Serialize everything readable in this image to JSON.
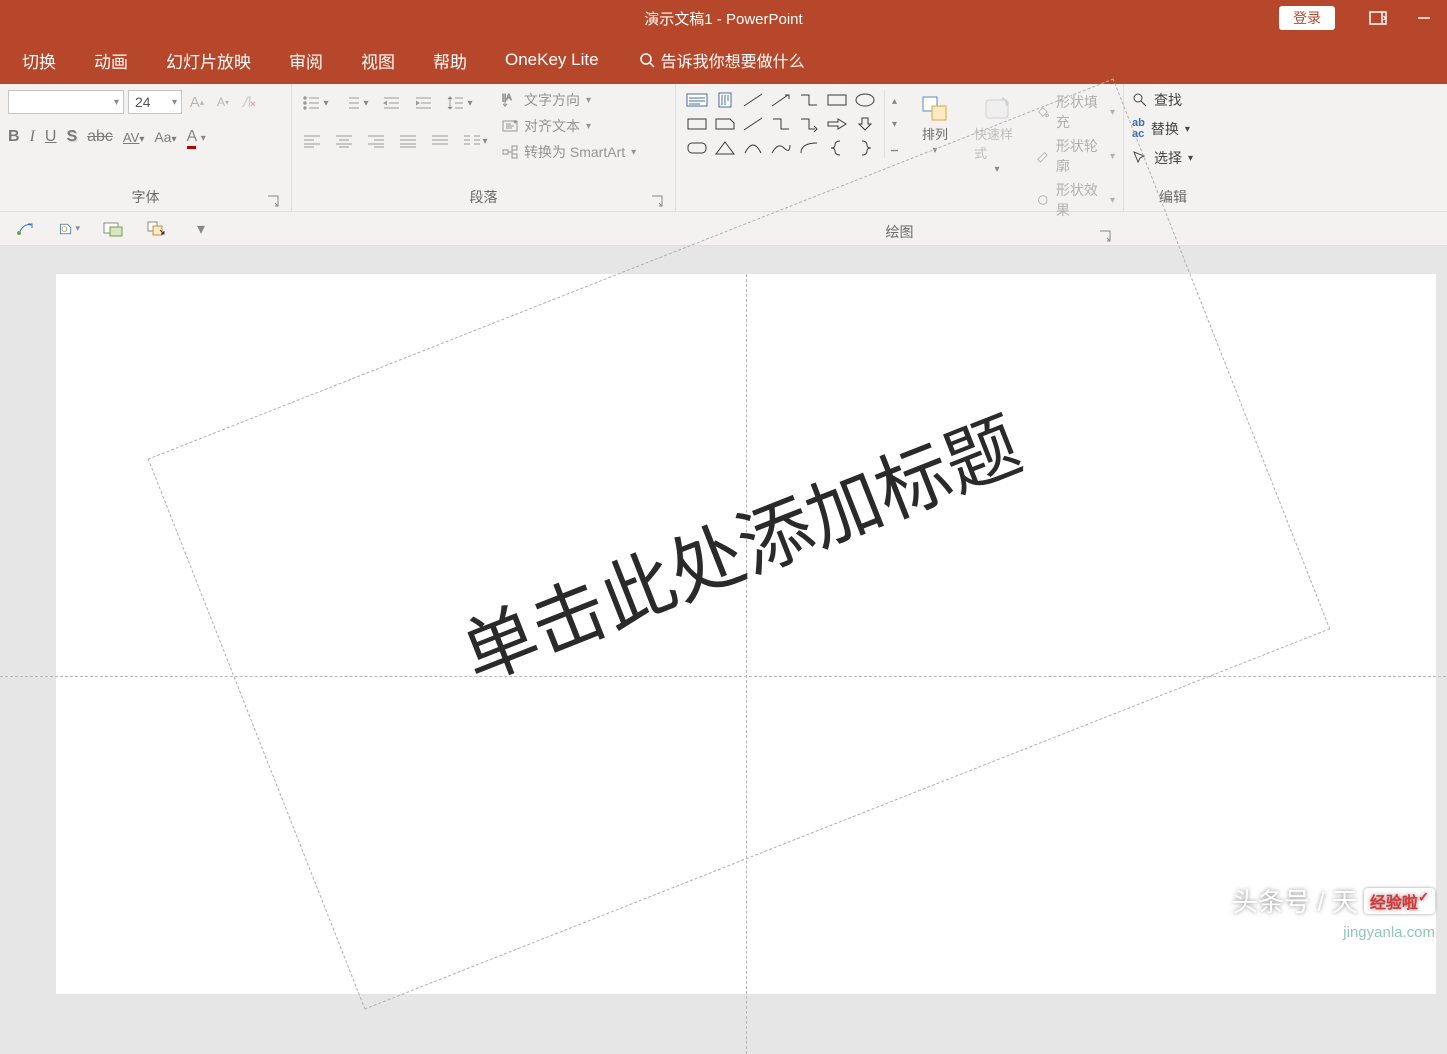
{
  "title_bar": {
    "title": "演示文稿1  -  PowerPoint",
    "signin": "登录"
  },
  "tabs": {
    "transition": "切换",
    "animation": "动画",
    "slideshow": "幻灯片放映",
    "review": "审阅",
    "view": "视图",
    "help": "帮助",
    "onekey": "OneKey Lite",
    "tellme": "告诉我你想要做什么"
  },
  "ribbon": {
    "font": {
      "label": "字体",
      "size": "24"
    },
    "paragraph": {
      "label": "段落",
      "text_direction": "文字方向",
      "align_text": "对齐文本",
      "convert_smartart": "转换为 SmartArt"
    },
    "drawing": {
      "label": "绘图",
      "arrange": "排列",
      "quick_styles": "快速样式",
      "shape_fill": "形状填充",
      "shape_outline": "形状轮廓",
      "shape_effects": "形状效果"
    },
    "editing": {
      "label": "编辑",
      "find": "查找",
      "replace": "替换",
      "select": "选择"
    }
  },
  "slide": {
    "title_placeholder": "单击此处添加标题"
  },
  "watermark": {
    "line1": "头条号 / 天",
    "badge": "经验啦",
    "line2": "jingyanla.com"
  }
}
